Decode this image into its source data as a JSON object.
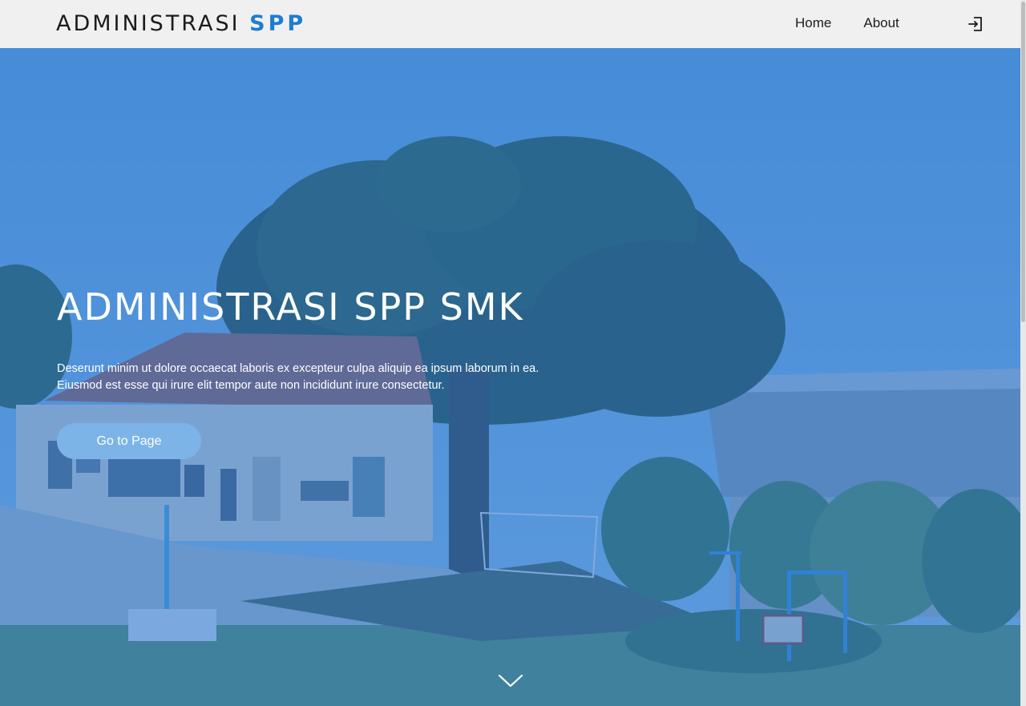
{
  "navbar": {
    "brand_main": "ADMINISTRASI",
    "brand_accent": "SPP",
    "links": [
      {
        "label": "Home"
      },
      {
        "label": "About"
      }
    ],
    "login_icon": "login-icon"
  },
  "hero": {
    "title": "ADMINISTRASI SPP SMK",
    "description_line1": "Deserunt minim ut dolore occaecat laboris ex excepteur culpa aliquip ea ipsum laborum in ea.",
    "description_line2": "Eiusmod est esse qui irure elit tempor aute non incididunt irure consectetur.",
    "button_label": "Go to Page",
    "scroll_icon": "chevron-down-icon"
  },
  "colors": {
    "accent": "#1e7dd0",
    "overlay": "#2878d7",
    "button": "#7cb4e8",
    "navbar_bg": "#f0f0f0"
  }
}
